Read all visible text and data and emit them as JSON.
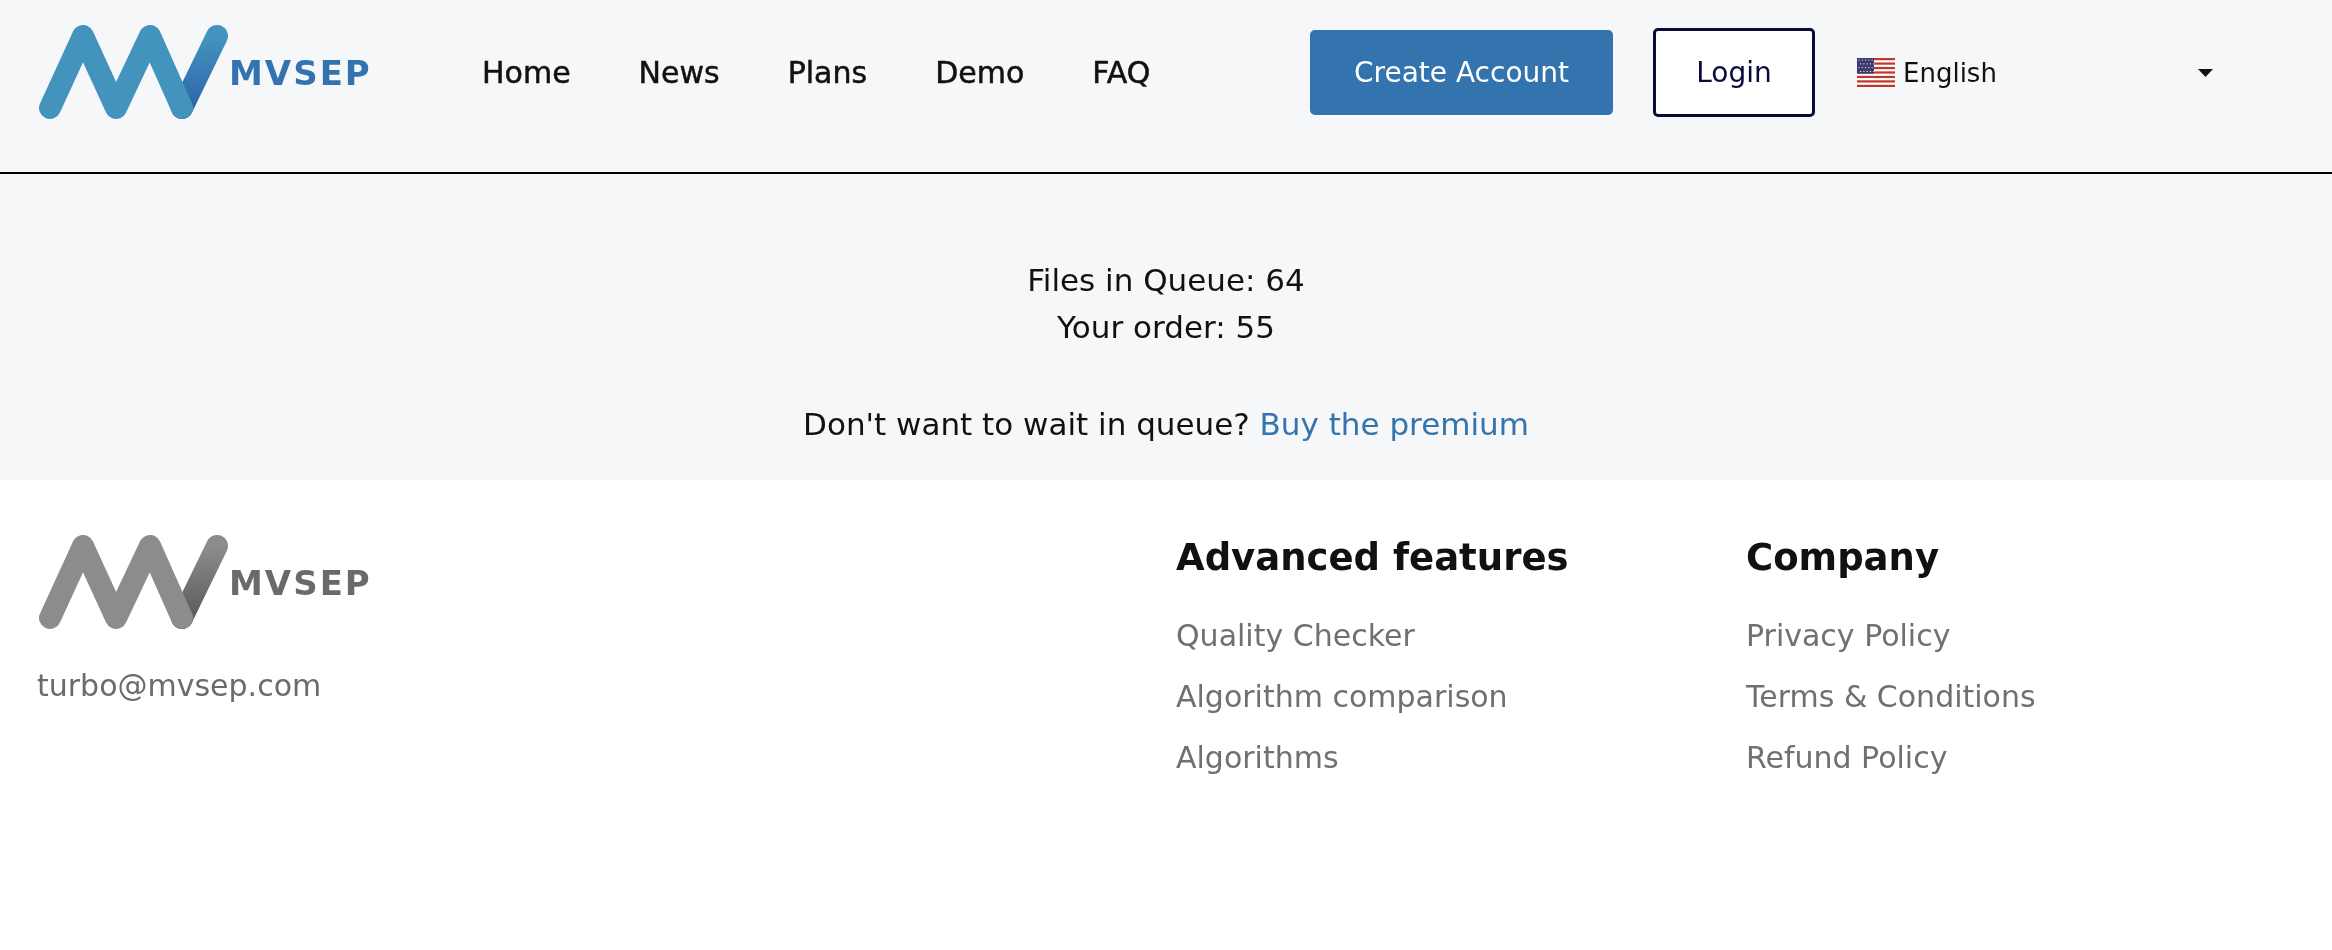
{
  "header": {
    "logo": {
      "wordmark": "MVSEP"
    },
    "nav": [
      "Home",
      "News",
      "Plans",
      "Demo",
      "FAQ"
    ],
    "buttons": [
      {
        "kind": "primary",
        "label": "Create Account"
      },
      {
        "kind": "outline",
        "label": "Login"
      }
    ],
    "language": {
      "label": "English"
    }
  },
  "queue": {
    "lines": [
      "Files in Queue: 64",
      "Your order: 55"
    ],
    "premium": {
      "text": "Don't want to wait in queue?",
      "link": "Buy the premium"
    }
  },
  "footer": {
    "logo": {
      "wordmark": "MVSEP"
    },
    "email": "turbo@mvsep.com",
    "columns": [
      {
        "title": "Advanced features",
        "links": [
          "Quality Checker",
          "Algorithm comparison",
          "Algorithms"
        ]
      },
      {
        "title": "Company",
        "links": [
          "Privacy Policy",
          "Terms & Conditions",
          "Refund Policy"
        ]
      }
    ]
  }
}
